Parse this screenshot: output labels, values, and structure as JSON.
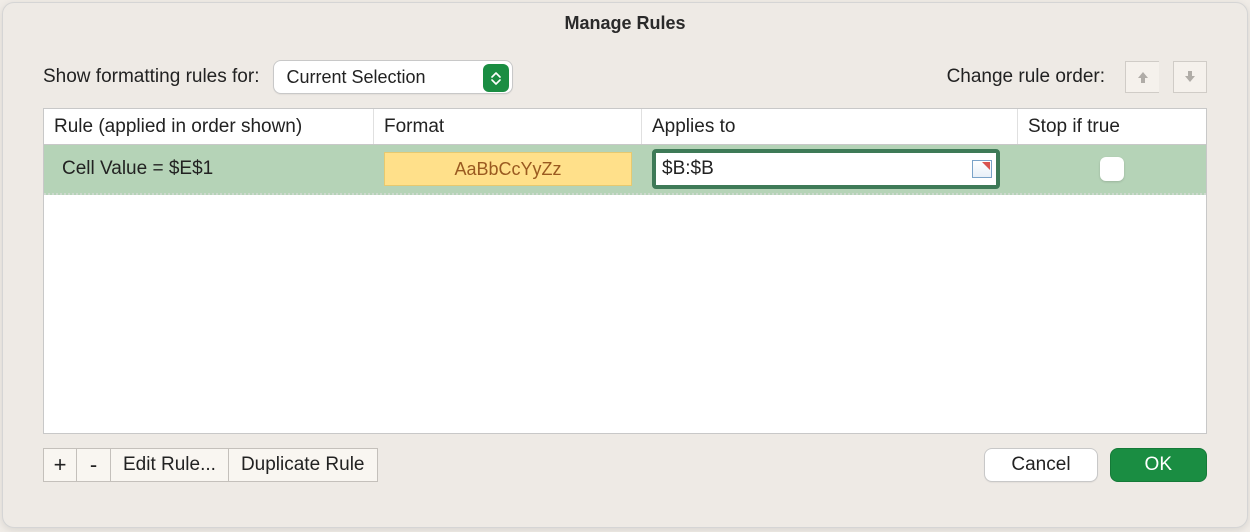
{
  "dialog": {
    "title": "Manage Rules"
  },
  "top": {
    "show_label": "Show formatting rules for:",
    "dropdown_value": "Current Selection",
    "order_label": "Change rule order:"
  },
  "columns": {
    "rule": "Rule (applied in order shown)",
    "format": "Format",
    "applies": "Applies to",
    "stop": "Stop if true"
  },
  "rules": [
    {
      "description": "Cell Value = $E$1",
      "format_preview": "AaBbCcYyZz",
      "applies_to": "$B:$B",
      "stop_if_true": false
    }
  ],
  "toolbar": {
    "add": "+",
    "remove": "-",
    "edit": "Edit Rule...",
    "duplicate": "Duplicate Rule"
  },
  "actions": {
    "cancel": "Cancel",
    "ok": "OK"
  }
}
